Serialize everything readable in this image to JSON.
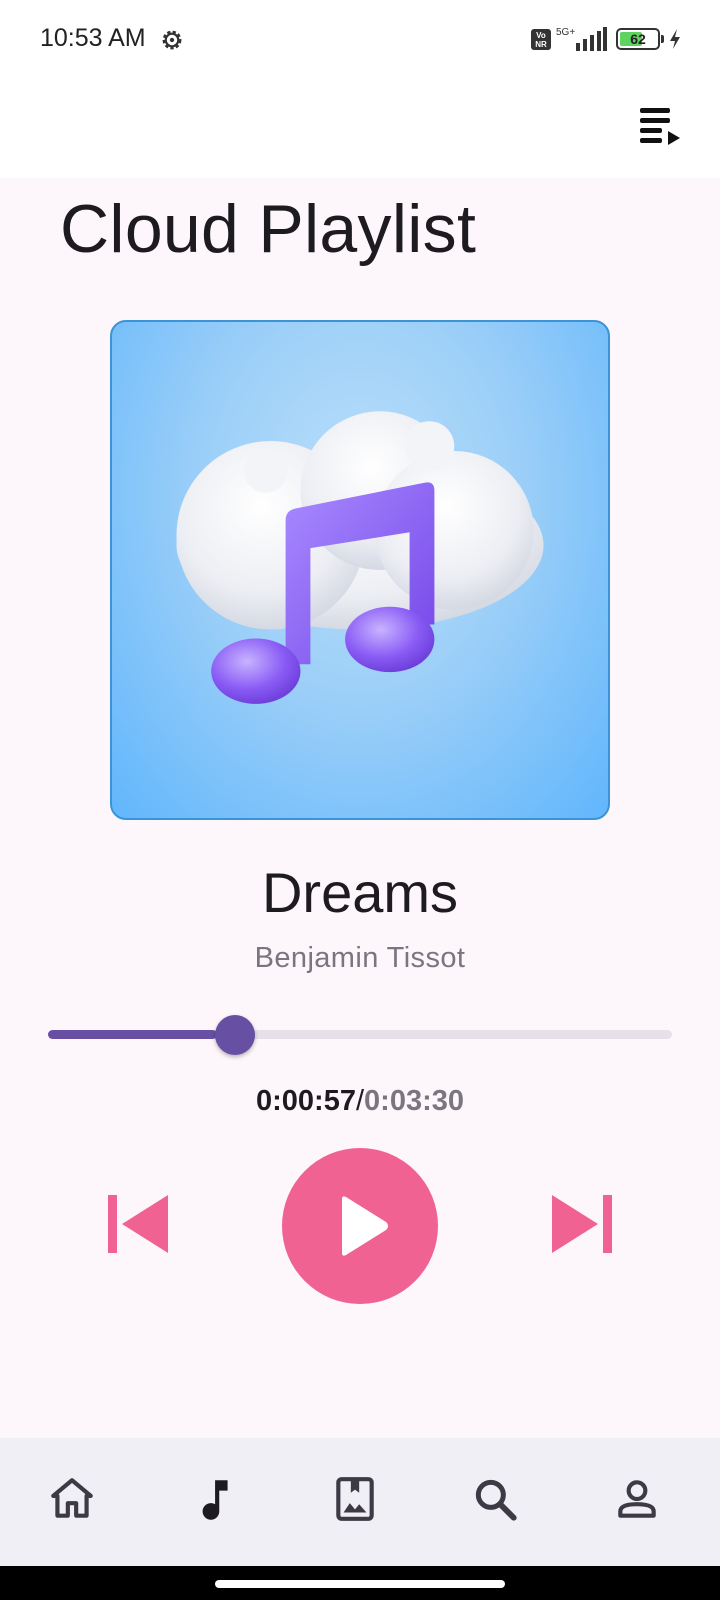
{
  "status_bar": {
    "time": "10:53 AM",
    "network": "5G+",
    "volte": "Vo NR",
    "battery_level": "62",
    "battery_fraction": 0.62
  },
  "app_bar": {
    "queue_icon": "playlist-play-icon"
  },
  "page": {
    "title": "Cloud Playlist"
  },
  "now_playing": {
    "artwork_icon": "cloud-music-note",
    "title": "Dreams",
    "artist": "Benjamin Tissot",
    "elapsed": "0:00:57",
    "separator": "/",
    "duration": "0:03:30",
    "progress_fraction": 0.271
  },
  "controls": {
    "previous_icon": "skip-previous-icon",
    "play_icon": "play-icon",
    "next_icon": "skip-next-icon",
    "accent_color": "#f06292",
    "slider_color": "#6750a4"
  },
  "bottom_nav": {
    "items": [
      {
        "icon": "home-icon",
        "selected": false
      },
      {
        "icon": "music-note-icon",
        "selected": true
      },
      {
        "icon": "photo-album-icon",
        "selected": false
      },
      {
        "icon": "search-icon",
        "selected": false
      },
      {
        "icon": "profile-icon",
        "selected": false
      }
    ]
  }
}
